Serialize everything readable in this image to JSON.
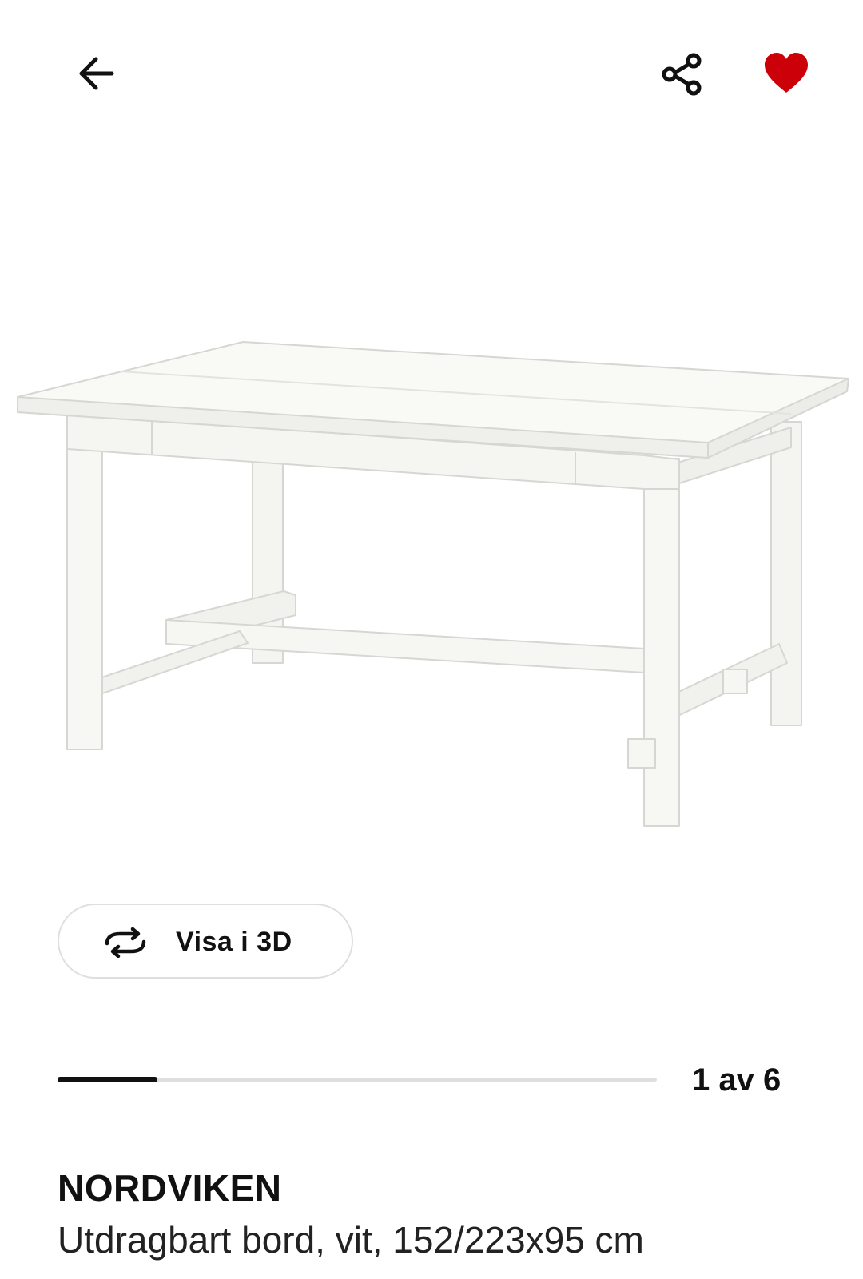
{
  "header": {
    "back_icon": "arrow-left-icon",
    "share_icon": "share-icon",
    "favorite_icon": "heart-filled-icon",
    "favorite_color": "#cc0008"
  },
  "product_image": {
    "subject": "table"
  },
  "view3d": {
    "icon": "rotate-icon",
    "label": "Visa i 3D"
  },
  "gallery": {
    "counter": "1 av 6",
    "current": 1,
    "total": 6
  },
  "product": {
    "name": "NORDVIKEN",
    "description": "Utdragbart bord, vit, 152/223x95 cm"
  }
}
